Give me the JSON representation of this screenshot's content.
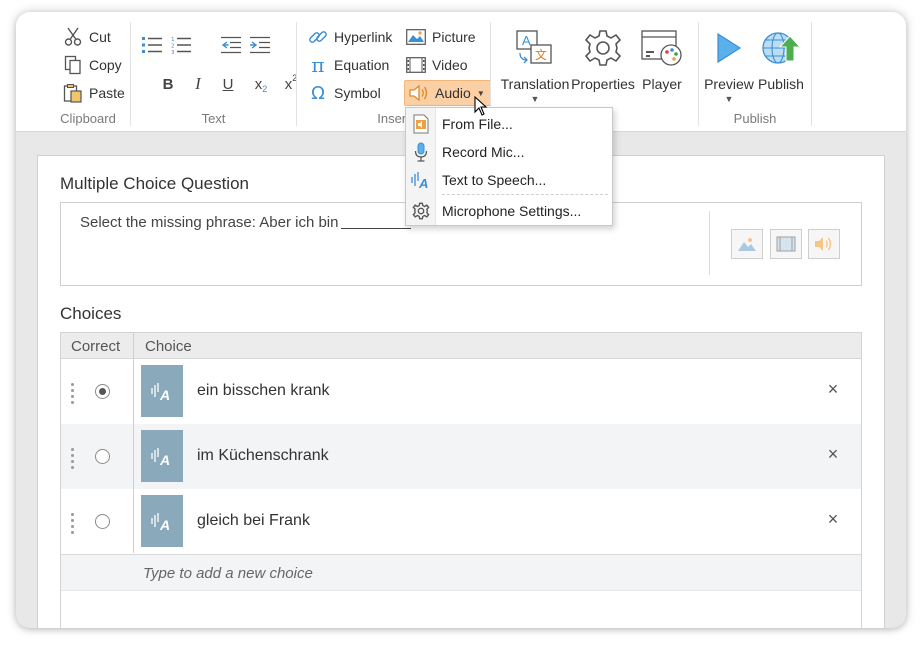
{
  "ribbon": {
    "clipboard": {
      "label": "Clipboard",
      "cut": "Cut",
      "copy": "Copy",
      "paste": "Paste"
    },
    "text": {
      "label": "Text",
      "bold": "B",
      "italic": "I",
      "underline": "U",
      "subscript": "x",
      "sub_mark": "2",
      "superscript": "x",
      "sup_mark": "2"
    },
    "insert": {
      "label": "Insert",
      "hyperlink": "Hyperlink",
      "equation": "Equation",
      "symbol": "Symbol",
      "picture": "Picture",
      "video": "Video",
      "audio": "Audio"
    },
    "translation": "Translation",
    "properties": "Properties",
    "player": "Player",
    "publish_group": {
      "label": "Publish",
      "preview": "Preview",
      "publish": "Publish"
    }
  },
  "audio_menu": {
    "items": [
      "From File...",
      "Record Mic...",
      "Text to Speech...",
      "Microphone Settings..."
    ]
  },
  "question": {
    "title": "Multiple Choice Question",
    "text": "Select the missing phrase:  Aber ich bin"
  },
  "choices": {
    "title": "Choices",
    "col_correct": "Correct",
    "col_choice": "Choice",
    "rows": [
      {
        "text": "ein bisschen krank",
        "correct": true
      },
      {
        "text": "im Küchenschrank",
        "correct": false
      },
      {
        "text": "gleich bei Frank",
        "correct": false
      }
    ],
    "add_placeholder": "Type to add a new choice",
    "delete_glyph": "×"
  },
  "colors": {
    "accent_blue": "#3a8fd6",
    "audio_highlight": "#fbd0a5",
    "tts_tile": "#8aaabb",
    "speaker_orange": "#f0a040"
  }
}
